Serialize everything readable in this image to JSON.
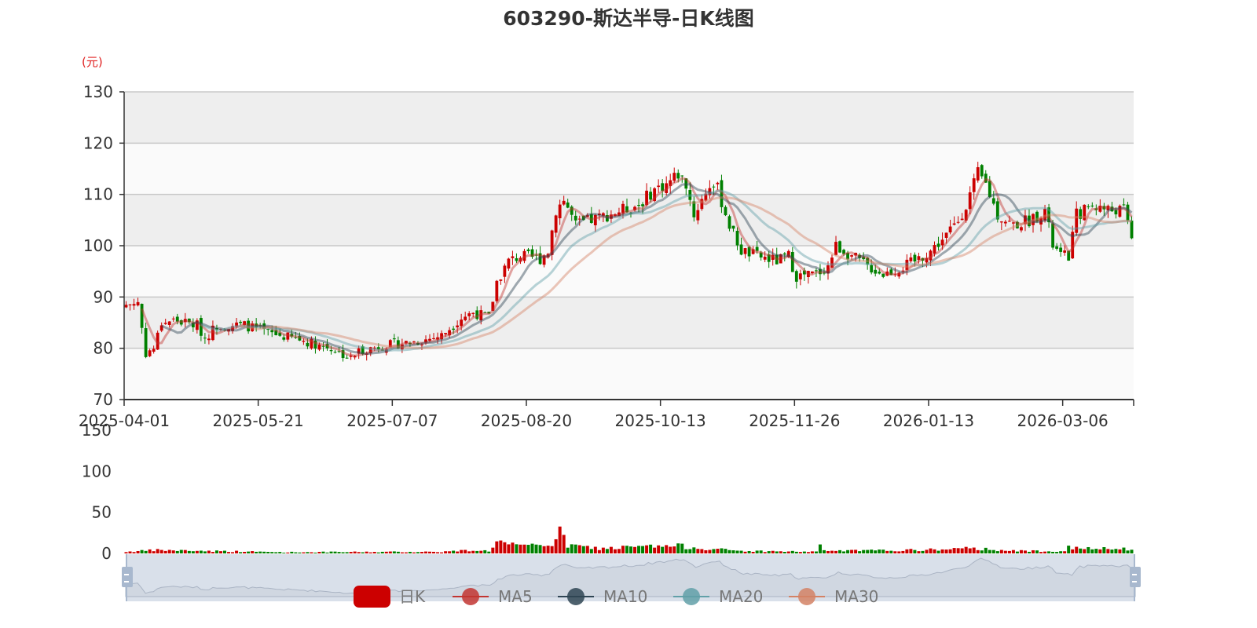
{
  "chart_data": {
    "type": "candlestick",
    "title": "603290-斯达半导-日K线图",
    "ylabel": "(元)",
    "ylim": [
      70,
      130
    ],
    "yticks": [
      "70",
      "80",
      "90",
      "100",
      "110",
      "120",
      "130"
    ],
    "volume_ylim": [
      0,
      150
    ],
    "volume_yticks": [
      "0",
      "50",
      "100",
      "150"
    ],
    "xticks": [
      "2025-04-01",
      "2025-05-21",
      "2025-07-07",
      "2025-08-20",
      "2025-10-13",
      "2025-11-26",
      "2026-01-13",
      "2026-03-06"
    ],
    "xtick_interval": 34,
    "num_days": 256,
    "close_waypoints": [
      [
        0,
        88.5
      ],
      [
        3,
        89
      ],
      [
        5,
        79
      ],
      [
        7,
        80
      ],
      [
        9,
        85
      ],
      [
        12,
        85.5
      ],
      [
        18,
        84.5
      ],
      [
        20,
        82
      ],
      [
        23,
        84.5
      ],
      [
        30,
        84.5
      ],
      [
        36,
        83
      ],
      [
        45,
        81.5
      ],
      [
        52,
        80
      ],
      [
        57,
        78
      ],
      [
        59,
        79.5
      ],
      [
        65,
        80.5
      ],
      [
        75,
        81.5
      ],
      [
        80,
        82.5
      ],
      [
        85,
        86
      ],
      [
        88,
        87
      ],
      [
        92,
        86
      ],
      [
        94,
        93
      ],
      [
        97,
        97
      ],
      [
        100,
        98
      ],
      [
        105,
        97.5
      ],
      [
        107,
        99
      ],
      [
        109,
        107
      ],
      [
        111,
        109
      ],
      [
        114,
        104
      ],
      [
        118,
        105
      ],
      [
        122,
        106
      ],
      [
        126,
        107
      ],
      [
        130,
        108
      ],
      [
        134,
        111
      ],
      [
        137,
        112
      ],
      [
        140,
        114
      ],
      [
        142,
        112
      ],
      [
        144,
        106
      ],
      [
        146,
        109
      ],
      [
        148,
        112
      ],
      [
        150,
        111
      ],
      [
        153,
        104
      ],
      [
        156,
        99
      ],
      [
        160,
        98
      ],
      [
        165,
        97
      ],
      [
        168,
        98
      ],
      [
        170,
        94
      ],
      [
        175,
        94.5
      ],
      [
        178,
        96
      ],
      [
        180,
        100
      ],
      [
        184,
        98
      ],
      [
        188,
        96
      ],
      [
        192,
        94.5
      ],
      [
        196,
        95.5
      ],
      [
        200,
        97
      ],
      [
        204,
        99
      ],
      [
        208,
        102
      ],
      [
        211,
        105
      ],
      [
        213,
        108
      ],
      [
        216,
        114
      ],
      [
        218,
        112
      ],
      [
        221,
        106
      ],
      [
        225,
        104
      ],
      [
        229,
        105
      ],
      [
        233,
        107
      ],
      [
        235,
        100
      ],
      [
        237,
        98
      ],
      [
        239,
        98
      ],
      [
        241,
        106
      ],
      [
        245,
        108
      ],
      [
        249,
        107
      ],
      [
        253,
        107
      ],
      [
        255,
        102
      ]
    ],
    "volume_waypoints": [
      [
        0,
        2
      ],
      [
        8,
        4
      ],
      [
        40,
        1.5
      ],
      [
        80,
        2
      ],
      [
        88,
        4
      ],
      [
        92,
        3
      ],
      [
        94,
        15
      ],
      [
        96,
        12
      ],
      [
        100,
        8
      ],
      [
        108,
        12
      ],
      [
        109,
        20
      ],
      [
        110,
        24
      ],
      [
        112,
        10
      ],
      [
        120,
        6
      ],
      [
        130,
        8
      ],
      [
        140,
        9
      ],
      [
        150,
        5
      ],
      [
        156,
        3
      ],
      [
        175,
        2
      ],
      [
        176,
        8
      ],
      [
        178,
        3
      ],
      [
        200,
        4
      ],
      [
        215,
        6
      ],
      [
        220,
        5
      ],
      [
        225,
        3
      ],
      [
        238,
        3
      ],
      [
        239,
        10
      ],
      [
        241,
        6
      ],
      [
        255,
        5
      ]
    ],
    "series": [
      {
        "name": "日K",
        "type": "candlestick"
      },
      {
        "name": "MA5",
        "period": 5
      },
      {
        "name": "MA10",
        "period": 10
      },
      {
        "name": "MA20",
        "period": 20
      },
      {
        "name": "MA30",
        "period": 30
      }
    ],
    "colors": {
      "up": "#cc0000",
      "down": "#008000",
      "MA5": "#c23531",
      "MA10": "#2f4554",
      "MA20": "#61a0a8",
      "MA30": "#d48265"
    },
    "legend_position": "bottom"
  }
}
